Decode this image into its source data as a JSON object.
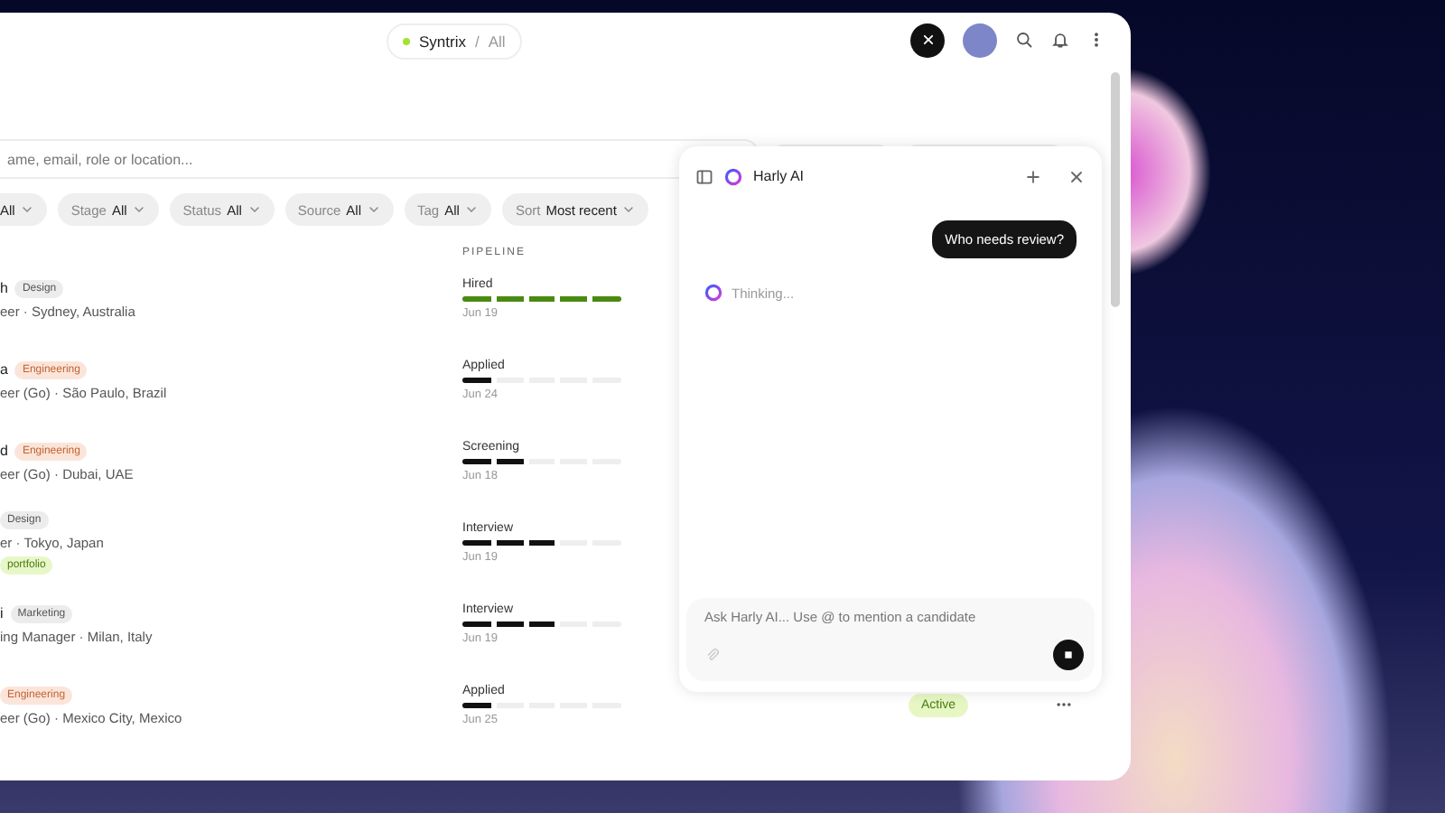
{
  "breadcrumb": {
    "workspace": "Syntrix",
    "separator": "/",
    "view": "All"
  },
  "search": {
    "placeholder": "ame, email, role or location..."
  },
  "filters": [
    {
      "value": "All"
    },
    {
      "label": "Stage",
      "value": "All"
    },
    {
      "label": "Status",
      "value": "All"
    },
    {
      "label": "Source",
      "value": "All"
    },
    {
      "label": "Tag",
      "value": "All"
    },
    {
      "label": "Sort",
      "value": "Most recent"
    }
  ],
  "table": {
    "columns": {
      "pipeline": "PIPELINE"
    },
    "rows": [
      {
        "name": "h",
        "tag": {
          "text": "Design",
          "color": "#ececec"
        },
        "subtitle": "eer · Sydney, Australia",
        "stage": "Hired",
        "level": 1.0,
        "color": "#4a8a12",
        "date": "Jun 19"
      },
      {
        "name": "a",
        "tag": {
          "text": "Engineering",
          "color": "#fbe5da"
        },
        "subtitle": "eer (Go) · São Paulo, Brazil",
        "stage": "Applied",
        "level": 0.2,
        "color": "#111111",
        "date": "Jun 24"
      },
      {
        "name": "d",
        "tag": {
          "text": "Engineering",
          "color": "#fbe5da"
        },
        "subtitle": "eer (Go) · Dubai, UAE",
        "stage": "Screening",
        "level": 0.4,
        "color": "#111111",
        "date": "Jun 18"
      },
      {
        "tag": {
          "text": "Design",
          "color": "#ececec"
        },
        "subtitle": "er · Tokyo, Japan",
        "note": "portfolio",
        "stage": "Interview",
        "level": 0.6,
        "color": "#111111",
        "date": "Jun 19"
      },
      {
        "name": "i",
        "tag": {
          "text": "Marketing",
          "color": "#ececec"
        },
        "subtitle": "ing Manager · Milan, Italy",
        "stage": "Interview",
        "level": 0.6,
        "color": "#111111",
        "date": "Jun 19"
      },
      {
        "tag": {
          "text": "Engineering",
          "color": "#fbe5da"
        },
        "subtitle": "eer (Go) · Mexico City, Mexico",
        "stage": "Applied",
        "level": 0.2,
        "color": "#111111",
        "date": "Jun 25",
        "status": "Active"
      }
    ]
  },
  "assistant": {
    "title": "Harly AI",
    "messages": [
      {
        "kind": "user",
        "text": "Who needs review?"
      },
      {
        "kind": "status",
        "text": "Thinking..."
      }
    ],
    "composer": {
      "placeholder": "Ask Harly AI... Use @ to mention a candidate"
    }
  }
}
